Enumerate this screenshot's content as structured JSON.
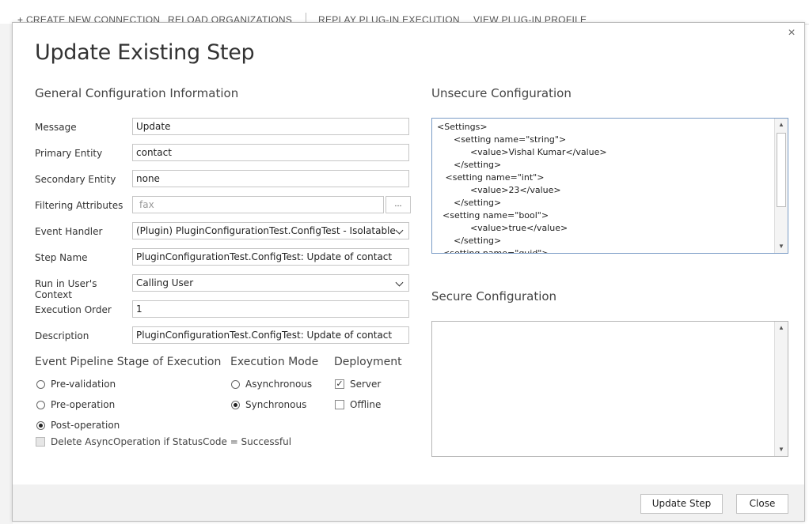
{
  "background_toolbar": {
    "items": [
      "+ CREATE NEW CONNECTION",
      "RELOAD ORGANIZATIONS",
      "REPLAY PLUG-IN EXECUTION",
      "VIEW PLUG-IN PROFILE"
    ]
  },
  "dialog": {
    "title": "Update Existing Step",
    "close_icon": "×",
    "general_section": "General Configuration Information",
    "fields": {
      "message": {
        "label": "Message",
        "value": "Update"
      },
      "primary_entity": {
        "label": "Primary Entity",
        "value": "contact"
      },
      "secondary_entity": {
        "label": "Secondary Entity",
        "value": "none"
      },
      "filtering_attributes": {
        "label": "Filtering Attributes",
        "value": "fax",
        "button": "..."
      },
      "event_handler": {
        "label": "Event Handler",
        "value": "(Plugin) PluginConfigurationTest.ConfigTest - Isolatable"
      },
      "step_name": {
        "label": "Step Name",
        "value": "PluginConfigurationTest.ConfigTest: Update of contact"
      },
      "run_in_context": {
        "label": "Run in User's Context",
        "value": "Calling User"
      },
      "execution_order": {
        "label": "Execution Order",
        "value": "1"
      },
      "description": {
        "label": "Description",
        "value": "PluginConfigurationTest.ConfigTest: Update of contact"
      }
    },
    "pipeline": {
      "title": "Event Pipeline Stage of Execution",
      "options": [
        "Pre-validation",
        "Pre-operation",
        "Post-operation"
      ],
      "selected": "Post-operation",
      "delete_async_label": "Delete AsyncOperation if StatusCode = Successful"
    },
    "execution_mode": {
      "title": "Execution Mode",
      "options": [
        "Asynchronous",
        "Synchronous"
      ],
      "selected": "Synchronous"
    },
    "deployment": {
      "title": "Deployment",
      "options": [
        "Server",
        "Offline"
      ],
      "checked": [
        "Server"
      ]
    },
    "unsecure_config": {
      "title": "Unsecure  Configuration",
      "lines": [
        "<Settings>",
        "      <setting name=\"string\">",
        "            <value>Vishal Kumar</value>",
        "      </setting>",
        "   <setting name=\"int\">",
        "            <value>23</value>",
        "      </setting>",
        "  <setting name=\"bool\">",
        "            <value>true</value>",
        "      </setting>",
        "  <setting name=\"guid\">"
      ]
    },
    "secure_config": {
      "title": "Secure  Configuration",
      "value": ""
    },
    "buttons": {
      "update": "Update Step",
      "close": "Close"
    }
  }
}
